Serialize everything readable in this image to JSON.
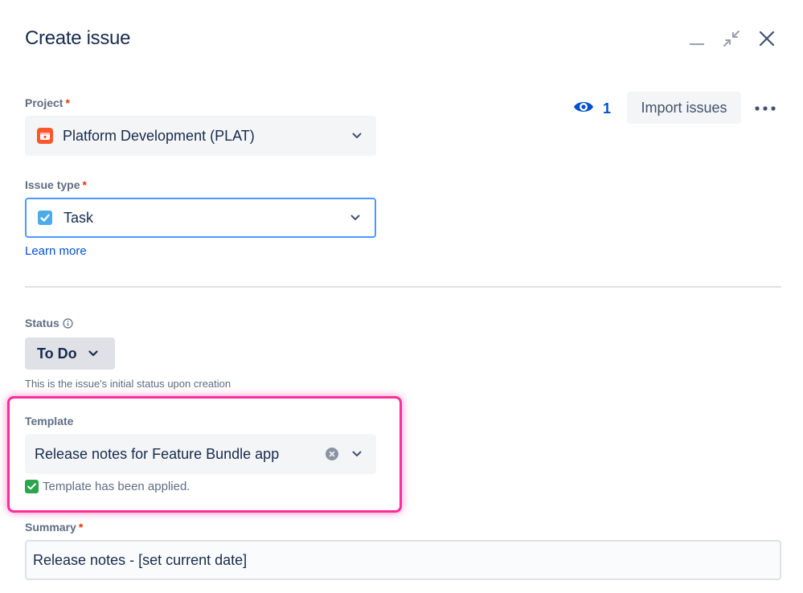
{
  "dialog": {
    "title": "Create issue"
  },
  "header_actions": {
    "watcher_count": "1",
    "import_label": "Import issues"
  },
  "project": {
    "label": "Project",
    "required_mark": "*",
    "value": "Platform Development (PLAT)",
    "icon": "project-icon"
  },
  "issue_type": {
    "label": "Issue type",
    "required_mark": "*",
    "value": "Task",
    "icon": "task-checkbox-icon",
    "help_link": "Learn more"
  },
  "status": {
    "label": "Status",
    "value": "To Do",
    "helper_text": "This is the issue's initial status upon creation"
  },
  "template": {
    "label": "Template",
    "value": "Release notes for Feature Bundle app",
    "applied_message": "Template has been applied."
  },
  "summary": {
    "label": "Summary",
    "required_mark": "*",
    "value": "Release notes - [set current date]"
  },
  "colors": {
    "brand_blue": "#0052CC",
    "focus_border": "#4C9AFF",
    "required_red": "#DE350B",
    "highlight_pink": "#FF2D9B",
    "success_green": "#2DA44E",
    "project_icon_red": "#FF5630",
    "task_icon_blue": "#4BADE8"
  }
}
